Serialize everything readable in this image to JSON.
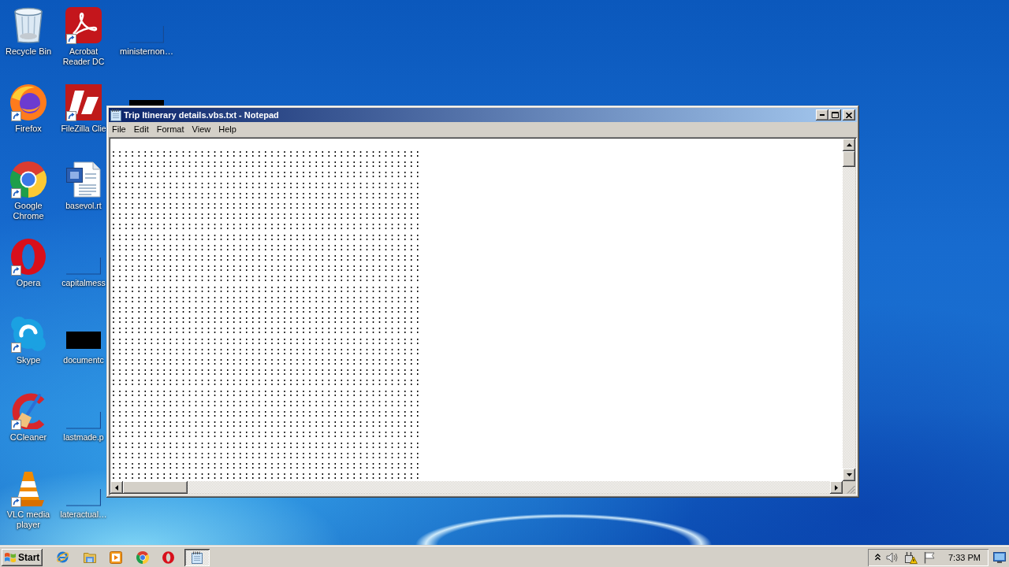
{
  "desktop": {
    "icons": [
      {
        "kind": "recycle-bin",
        "label": "Recycle Bin",
        "shortcut": false
      },
      {
        "kind": "firefox",
        "label": "Firefox",
        "shortcut": true
      },
      {
        "kind": "chrome",
        "label": "Google Chrome",
        "shortcut": true
      },
      {
        "kind": "opera",
        "label": "Opera",
        "shortcut": true
      },
      {
        "kind": "skype",
        "label": "Skype",
        "shortcut": true
      },
      {
        "kind": "ccleaner",
        "label": "CCleaner",
        "shortcut": true
      },
      {
        "kind": "vlc",
        "label": "VLC media player",
        "shortcut": true
      },
      {
        "kind": "acrobat",
        "label": "Acrobat Reader DC",
        "shortcut": true
      },
      {
        "kind": "filezilla",
        "label": "FileZilla Clie",
        "shortcut": true
      },
      {
        "kind": "word-doc",
        "label": "basevol.rt",
        "shortcut": false
      },
      {
        "kind": "blank-file",
        "label": "capitalmess",
        "shortcut": false
      },
      {
        "kind": "dark-file",
        "label": "documentc",
        "shortcut": false
      },
      {
        "kind": "blank-file",
        "label": "lastmade.p",
        "shortcut": false
      },
      {
        "kind": "blank-file",
        "label": "lateractual…",
        "shortcut": false
      },
      {
        "kind": "blank-file",
        "label": "ministernon…",
        "shortcut": false
      },
      {
        "kind": "covered-file",
        "shortcut": false
      }
    ]
  },
  "notepad": {
    "title": "Trip Itinerary details.vbs.txt - Notepad",
    "menu": [
      "File",
      "Edit",
      "Format",
      "View",
      "Help"
    ],
    "lines": [
      ":::::::::::::::::::::::::::::::::::::::::::::::::",
      ":::::::::::::::::::::::::::::::::::::::::::::::::",
      ":::::::::::::::::::::::::::::::::::::::::::::::::",
      ":::::::::::::::::::::::::::::::::::::::::::::::::",
      ":::::::::::::::::::::::::::::::::::::::::::::::::",
      ":::::::::::::::::::::::::::::::::::::::::::::::::",
      ":::::::::::::::::::::::::::::::::::::::::::::::::",
      ":::::::::::::::::::::::::::::::::::::::::::::::::",
      ":::::::::::::::::::::::::::::::::::::::::::::::::",
      ":::::::::::::::::::::::::::::::::::::::::::::::::",
      ":::::::::::::::::::::::::::::::::::::::::::::::::",
      ":::::::::::::::::::::::::::::::::::::::::::::::::",
      ":::::::::::::::::::::::::::::::::::::::::::::::::",
      ":::::::::::::::::::::::::::::::::::::::::::::::::",
      ":::::::::::::::::::::::::::::::::::::::::::::::::",
      ":::::::::::::::::::::::::::::::::::::::::::::::::",
      ":::::::::::::::::::::::::::::::::::::::::::::::::",
      ":::::::::::::::::::::::::::::::::::::::::::::::::",
      ":::::::::::::::::::::::::::::::::::::::::::::::::",
      ":::::::::::::::::::::::::::::::::::::::::::::::::",
      ":::::::::::::::::::::::::::::::::::::::::::::::::",
      ":::::::::::::::::::::::::::::::::::::::::::::::::",
      ":::::::::::::::::::::::::::::::::::::::::::::::::",
      ":::::::::::::::::::::::::::::::::::::::::::::::::",
      ":::::::::::::::::::::::::::::::::::::::::::::::::",
      ":::::::::::::::::::::::::::::::::::::::::::::::::",
      ":::::::::::::::::::::::::::::::::::::::::::::::::",
      ":::::::::::::::::::::::::::::::::::::::::::::::::",
      ":::::::::::::::::::::::::::::::::::::::::::::::::",
      ":::::::::::::::::::::::::::::::::::::::::::::::::",
      ":::::::::::::::::::::::::::::::::::::::::::::::::",
      ":::::::::::::::::::::::::::::::::::::::::::::::::"
    ]
  },
  "taskbar": {
    "start": "Start",
    "quick_launch": [
      {
        "kind": "ie"
      },
      {
        "kind": "explorer"
      },
      {
        "kind": "media-player"
      },
      {
        "kind": "chrome"
      },
      {
        "kind": "opera"
      }
    ],
    "tasks": [
      {
        "kind": "notepad",
        "selected": true
      }
    ],
    "tray": {
      "icons": [
        {
          "kind": "chevron"
        },
        {
          "kind": "speaker"
        },
        {
          "kind": "network-warning"
        },
        {
          "kind": "flag"
        }
      ],
      "clock": "7:33 PM"
    }
  }
}
